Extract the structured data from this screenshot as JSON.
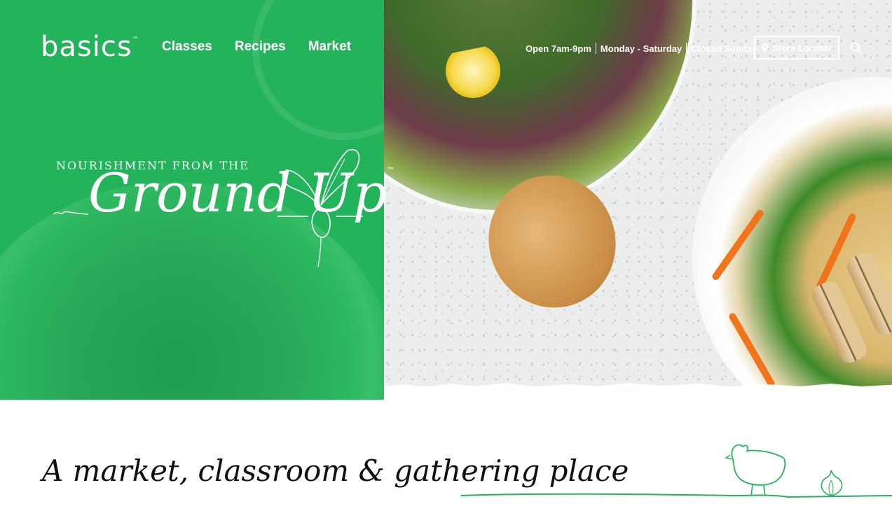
{
  "header": {
    "logo_text": "basics",
    "logo_tm": "™",
    "nav": [
      {
        "label": "Classes"
      },
      {
        "label": "Recipes"
      },
      {
        "label": "Market"
      }
    ],
    "hours": {
      "open": "Open 7am-9pm",
      "days": "Monday - Saturday",
      "closed": "Closed Sunday"
    },
    "store_locator_label": "Store Locator",
    "icons": {
      "location": "map-pin-icon",
      "search": "search-icon"
    }
  },
  "hero": {
    "tagline_top": "NOURISHMENT FROM THE",
    "tagline_script": "Ground Up",
    "tagline_tm": "™"
  },
  "intro": {
    "headline": "A market, classroom & gathering place"
  },
  "colors": {
    "brand_green": "#23b35a",
    "white": "#ffffff",
    "text_dark": "#111111"
  }
}
